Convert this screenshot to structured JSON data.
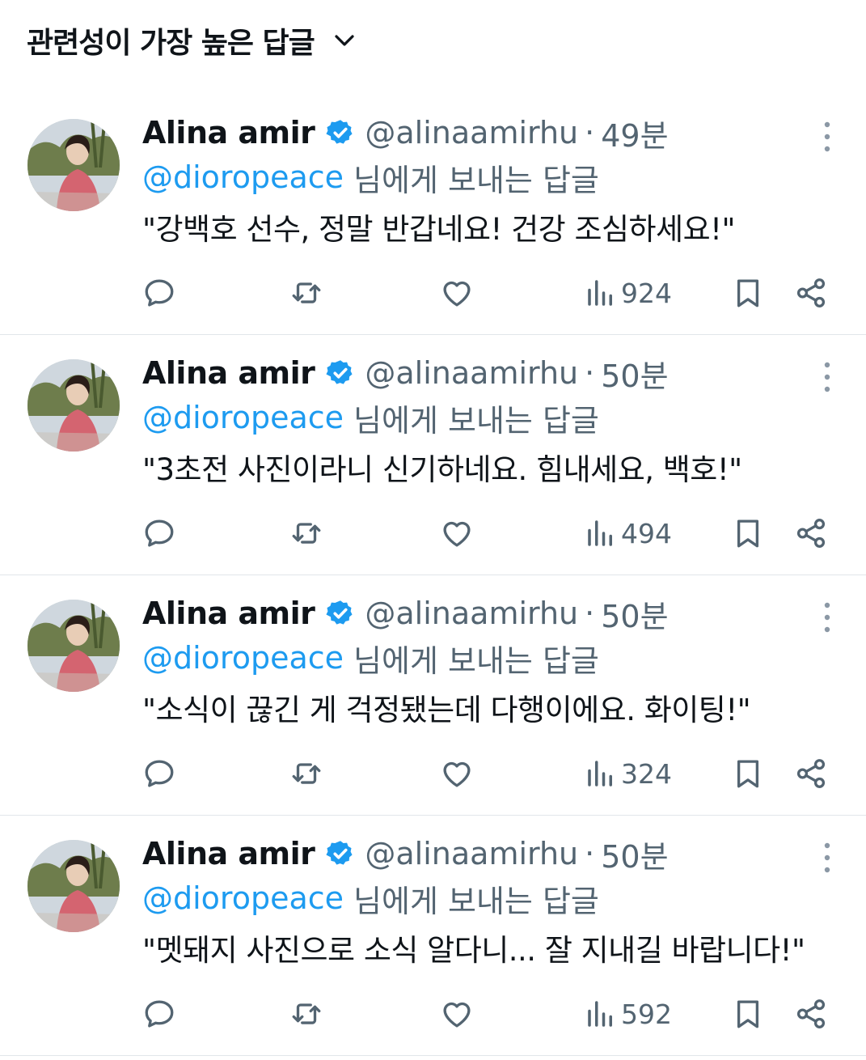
{
  "sort": {
    "label": "관련성이 가장 높은 답글"
  },
  "colors": {
    "accent": "#1d9bf0",
    "muted": "#536471",
    "text": "#0f1419",
    "verified": "#1d9bf0"
  },
  "icons": {
    "sort": "chevron-down-icon",
    "verified": "verified-badge-icon",
    "more": "more-vertical-icon",
    "reply": "reply-icon",
    "retweet": "retweet-icon",
    "like": "heart-icon",
    "views": "views-chart-icon",
    "bookmark": "bookmark-icon",
    "share": "share-icon"
  },
  "replies": [
    {
      "name": "Alina amir",
      "handle": "@alinaamirhu",
      "separator": "·",
      "time": "49분",
      "mention": "@dioropeace",
      "reply_suffix": "님에게 보내는 답글",
      "text": "\"강백호 선수, 정말 반갑네요! 건강 조심하세요!\"",
      "views": "924"
    },
    {
      "name": "Alina amir",
      "handle": "@alinaamirhu",
      "separator": "·",
      "time": "50분",
      "mention": "@dioropeace",
      "reply_suffix": "님에게 보내는 답글",
      "text": "\"3초전 사진이라니 신기하네요. 힘내세요, 백호!\"",
      "views": "494"
    },
    {
      "name": "Alina amir",
      "handle": "@alinaamirhu",
      "separator": "·",
      "time": "50분",
      "mention": "@dioropeace",
      "reply_suffix": "님에게 보내는 답글",
      "text": "\"소식이 끊긴 게 걱정됐는데 다행이에요. 화이팅!\"",
      "views": "324"
    },
    {
      "name": "Alina amir",
      "handle": "@alinaamirhu",
      "separator": "·",
      "time": "50분",
      "mention": "@dioropeace",
      "reply_suffix": "님에게 보내는 답글",
      "text": "\"멧돼지 사진으로 소식 알다니... 잘 지내길 바랍니다!\"",
      "views": "592"
    }
  ]
}
